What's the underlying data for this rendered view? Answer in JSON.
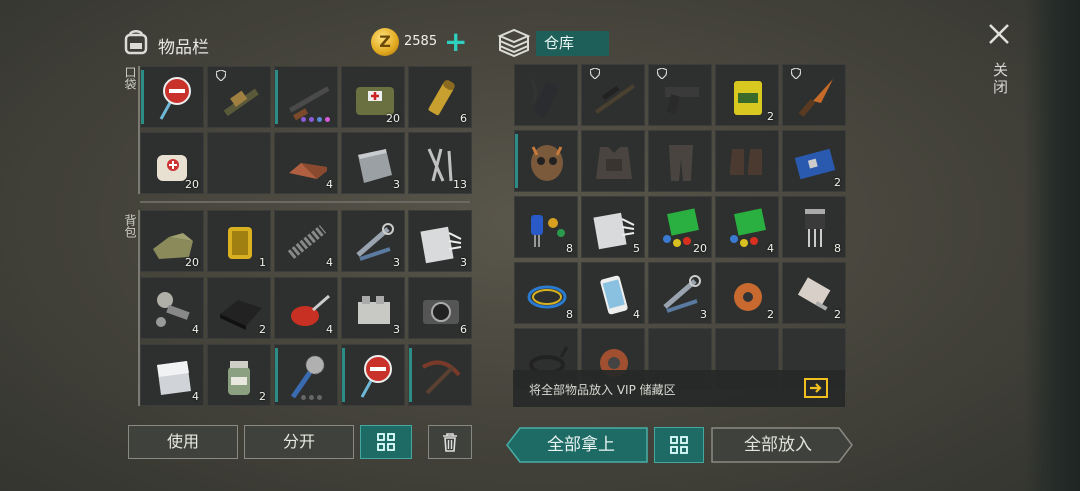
{
  "header": {
    "inventory_title": "物品栏",
    "coin_symbol": "Z",
    "coin_amount": "2585",
    "storage_tab": "仓库",
    "close_label": "关闭"
  },
  "side_labels": {
    "pocket": "口袋",
    "backpack": "背包"
  },
  "inventory": {
    "pocket": [
      {
        "item": "stop-sign-icon",
        "count": ""
      },
      {
        "item": "grenade-launcher-icon",
        "count": ""
      },
      {
        "item": "shotgun-icon",
        "count": ""
      },
      {
        "item": "medkit-bag-icon",
        "count": "20"
      },
      {
        "item": "ammo-cartridge-icon",
        "count": "6"
      },
      {
        "item": "bandage-icon",
        "count": "20"
      },
      {
        "item": "empty",
        "count": ""
      },
      {
        "item": "copper-ingot-icon",
        "count": "4"
      },
      {
        "item": "steel-plate-icon",
        "count": "3"
      },
      {
        "item": "nails-icon",
        "count": "13"
      }
    ],
    "backpack": [
      {
        "item": "cloth-icon",
        "count": "20"
      },
      {
        "item": "oil-filter-icon",
        "count": "1"
      },
      {
        "item": "spring-icon",
        "count": "4"
      },
      {
        "item": "tools-icon",
        "count": "3"
      },
      {
        "item": "fiberglass-icon",
        "count": "3"
      },
      {
        "item": "mechanical-parts-icon",
        "count": "4"
      },
      {
        "item": "rubber-sheet-icon",
        "count": "2"
      },
      {
        "item": "oil-can-icon",
        "count": "4"
      },
      {
        "item": "engine-block-icon",
        "count": "3"
      },
      {
        "item": "camera-icon",
        "count": "6"
      },
      {
        "item": "aluminum-sheet-icon",
        "count": "4"
      },
      {
        "item": "chemical-jar-icon",
        "count": "2"
      },
      {
        "item": "saw-club-icon",
        "count": ""
      },
      {
        "item": "stop-sign-icon",
        "count": ""
      },
      {
        "item": "crossbow-icon",
        "count": ""
      }
    ]
  },
  "storage": [
    {
      "item": "silencer-icon",
      "count": ""
    },
    {
      "item": "sniper-rifle-icon",
      "count": ""
    },
    {
      "item": "pistol-icon",
      "count": ""
    },
    {
      "item": "battery-icon",
      "count": "2"
    },
    {
      "item": "knife-icon",
      "count": ""
    },
    {
      "item": "skull-mask-icon",
      "count": ""
    },
    {
      "item": "armor-vest-icon",
      "count": ""
    },
    {
      "item": "armor-pants-icon",
      "count": ""
    },
    {
      "item": "armor-boots-icon",
      "count": ""
    },
    {
      "item": "circuit-board-icon",
      "count": "2"
    },
    {
      "item": "capacitors-icon",
      "count": "8"
    },
    {
      "item": "fiberglass-icon",
      "count": "5"
    },
    {
      "item": "circuit-components-icon",
      "count": "20"
    },
    {
      "item": "circuit-components-icon",
      "count": "4"
    },
    {
      "item": "transistor-icon",
      "count": "8"
    },
    {
      "item": "wires-icon",
      "count": "8"
    },
    {
      "item": "smartphone-icon",
      "count": "4"
    },
    {
      "item": "tools-icon",
      "count": "3"
    },
    {
      "item": "copper-coil-icon",
      "count": "2"
    },
    {
      "item": "electric-motor-icon",
      "count": "2"
    },
    {
      "item": "cable-icon",
      "count": ""
    },
    {
      "item": "copper-wire-spool-icon",
      "count": ""
    },
    {
      "item": "empty",
      "count": ""
    },
    {
      "item": "empty",
      "count": ""
    },
    {
      "item": "empty",
      "count": ""
    }
  ],
  "vip_bar": {
    "text": "将全部物品放入 VIP 储藏区"
  },
  "buttons": {
    "use": "使用",
    "split": "分开",
    "take_all": "全部拿上",
    "put_all": "全部放入"
  },
  "colors": {
    "accent_teal": "#1e6a65",
    "coin_gold": "#e0a81e",
    "plus_teal": "#2fd0c0"
  }
}
